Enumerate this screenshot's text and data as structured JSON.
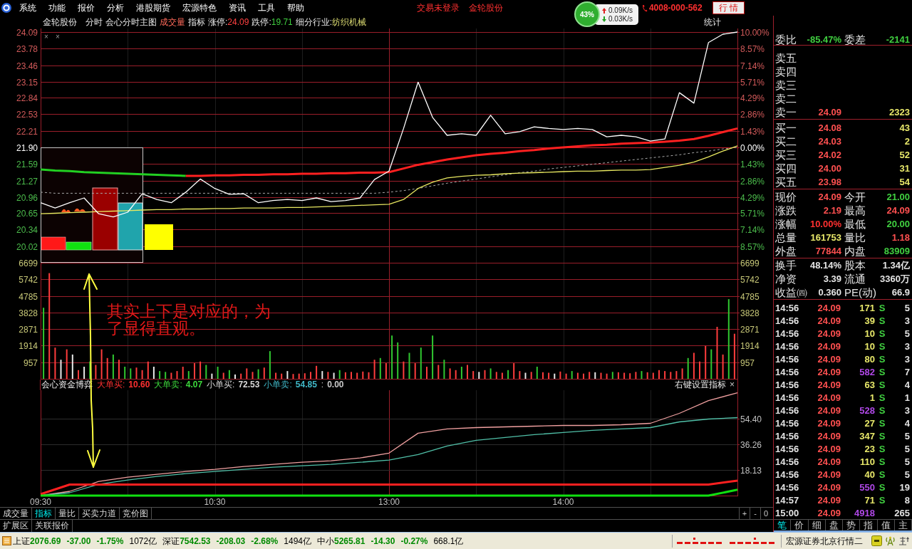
{
  "menu_bar": {
    "items": [
      "系统",
      "功能",
      "报价",
      "分析",
      "港股期货",
      "宏源特色",
      "资讯",
      "工具",
      "帮助"
    ],
    "login_status": "交易未登录",
    "stock_name": "金轮股份",
    "phone": "4008-000-562",
    "quote_button": "行 情"
  },
  "network_monitor": {
    "percent": "43%",
    "upload": "0.09K/s",
    "download": "0.03K/s"
  },
  "chart_header": {
    "stock_name": "金轮股份",
    "items": [
      {
        "label": "分时",
        "highlighted": false
      },
      {
        "label": "会心分时主图",
        "highlighted": false
      },
      {
        "label": "成交量",
        "highlighted": true
      },
      {
        "label": "指标",
        "highlighted": false
      }
    ],
    "limit_up": {
      "label": "涨停:",
      "value": "24.09"
    },
    "limit_down": {
      "label": "跌停:",
      "value": "19.71"
    },
    "industry": {
      "label": "细分行业:",
      "value": "纺织机械"
    },
    "stats_button": "统计"
  },
  "price_pane": {
    "close_marks": [
      "×",
      "×"
    ],
    "percent_labels": [
      "10.00%",
      "8.57%",
      "7.14%",
      "5.71%",
      "4.29%",
      "2.86%",
      "1.43%",
      "0.00%",
      "1.43%",
      "2.86%",
      "4.29%",
      "5.71%",
      "7.14%",
      "8.57%"
    ],
    "chart_data": {
      "type": "line",
      "categories": [
        null,
        null,
        null,
        null,
        null,
        null,
        null,
        null,
        null,
        null,
        null,
        null,
        null,
        null,
        null,
        null,
        null,
        null,
        null,
        null,
        null,
        null,
        null,
        null,
        null,
        null,
        null,
        null,
        null,
        null,
        null,
        null,
        null,
        null,
        null,
        null,
        null,
        null,
        null,
        null,
        null,
        null,
        null,
        null,
        null,
        null,
        null,
        null,
        null
      ],
      "ylim": [
        19.71,
        24.09
      ],
      "yticks": [
        24.09,
        23.78,
        23.46,
        23.15,
        22.84,
        22.53,
        22.21,
        {
          "value": 21.9,
          "label": "21.90"
        },
        21.59,
        21.27,
        20.96,
        20.65,
        20.34,
        20.02
      ],
      "grid": true,
      "ref_lines": [
        {
          "axis": "y",
          "value": 21.9
        }
      ],
      "series": [
        {
          "color": "#a8a8a8",
          "line_style": "dashed",
          "values": [
            21.05,
            21.03,
            21.03,
            21.03,
            21.03,
            21.03,
            21.03,
            21.03,
            21.03,
            21.03,
            21.03,
            21.03,
            21.03,
            21.03,
            21.03,
            21.03,
            21.03,
            21.03,
            21.03,
            21.03,
            21.03,
            21.03,
            21.03,
            21.03,
            21.05,
            21.08,
            21.12,
            21.17,
            21.22,
            21.26,
            21.3,
            21.34,
            21.38,
            21.42,
            21.45,
            21.49,
            21.52,
            21.55,
            21.58,
            21.61,
            21.64,
            21.67,
            21.7,
            21.73,
            21.76,
            21.8,
            21.83,
            21.87,
            21.9
          ]
        },
        {
          "color": "#22d022",
          "line_style": "solid",
          "values": [
            21.48,
            21.46,
            21.45,
            21.43,
            21.42,
            21.41,
            21.4,
            21.39,
            21.38,
            21.37,
            21.36,
            null,
            null,
            null,
            null,
            null,
            null,
            null,
            null,
            null,
            null,
            null,
            null,
            null,
            null,
            null,
            null,
            null,
            null,
            null,
            null,
            null,
            null,
            null,
            null,
            null,
            null,
            null,
            null,
            null,
            null,
            null,
            null,
            null,
            null,
            null,
            null,
            null,
            null
          ]
        },
        {
          "color": "#ff2020",
          "line_style": "solid",
          "values": [
            null,
            null,
            null,
            null,
            null,
            null,
            null,
            null,
            null,
            null,
            21.36,
            21.36,
            21.37,
            21.37,
            21.38,
            21.38,
            21.39,
            21.39,
            21.4,
            21.4,
            21.41,
            21.41,
            21.42,
            21.42,
            21.43,
            21.5,
            21.57,
            21.62,
            21.67,
            21.71,
            21.75,
            21.78,
            21.8,
            21.83,
            21.85,
            21.88,
            21.9,
            21.92,
            21.94,
            21.95,
            21.97,
            21.98,
            21.99,
            22.01,
            22.03,
            22.06,
            22.12,
            22.19,
            22.26
          ]
        },
        {
          "color": "#e8e860",
          "line_style": "solid",
          "values": [
            20.64,
            20.65,
            20.66,
            20.67,
            20.68,
            20.69,
            20.7,
            20.71,
            20.72,
            20.72,
            20.73,
            20.73,
            20.74,
            20.74,
            20.75,
            20.75,
            20.75,
            20.76,
            20.76,
            20.77,
            20.78,
            20.79,
            20.8,
            20.81,
            20.82,
            20.91,
            21.12,
            21.24,
            21.32,
            21.35,
            21.37,
            21.38,
            21.4,
            21.41,
            21.42,
            21.43,
            21.44,
            21.45,
            21.45,
            21.46,
            21.47,
            21.47,
            21.48,
            21.52,
            21.56,
            21.62,
            21.72,
            21.83,
            21.93
          ]
        },
        {
          "color": "#ffffff",
          "line_style": "solid",
          "values": [
            20.85,
            20.75,
            20.85,
            20.94,
            20.64,
            20.58,
            20.67,
            21.02,
            20.91,
            20.85,
            21.05,
            21.3,
            21.12,
            21.01,
            21.02,
            20.85,
            20.89,
            20.91,
            20.89,
            20.94,
            20.87,
            20.89,
            20.94,
            21.29,
            21.45,
            22.26,
            23.14,
            22.47,
            22.13,
            22.16,
            22.13,
            22.51,
            22.16,
            22.2,
            22.29,
            22.26,
            22.24,
            22.26,
            22.24,
            22.1,
            22.13,
            22.1,
            22.02,
            22.06,
            22.94,
            22.74,
            23.89,
            24.05,
            24.09
          ]
        }
      ]
    }
  },
  "volume_pane": {
    "right_labels": [
      "6699",
      "5742",
      "4785",
      "3828",
      "2871",
      "1914",
      "957"
    ],
    "chart_data": {
      "type": "bar",
      "stacked": true,
      "categories": [
        null,
        null,
        null,
        null,
        null,
        null,
        null,
        null,
        null,
        null,
        null,
        null,
        null,
        null,
        null,
        null,
        null,
        null,
        null,
        null,
        null,
        null,
        null,
        null,
        null,
        null,
        null,
        null,
        null,
        null,
        null,
        null,
        null,
        null,
        null,
        null,
        null,
        null,
        null,
        null,
        null,
        null,
        null,
        null,
        null,
        null,
        null,
        null,
        null,
        null,
        null,
        null,
        null,
        null,
        null,
        null,
        null,
        null,
        null,
        null,
        null,
        null,
        null,
        null,
        null,
        null,
        null,
        null,
        null,
        null,
        null,
        null,
        null,
        null,
        null,
        null,
        null,
        null,
        null,
        null,
        null,
        null,
        null,
        null,
        null,
        null,
        null,
        null,
        null,
        null,
        null,
        null,
        null,
        null,
        null,
        null,
        null,
        null,
        null,
        null,
        null,
        null,
        null,
        null,
        null,
        null,
        null,
        null,
        null,
        null,
        null,
        null,
        null,
        null,
        null,
        null,
        null,
        null,
        null,
        null
      ],
      "ylim": [
        0,
        6699
      ],
      "yticks": [
        6699,
        5742,
        4785,
        3828,
        2871,
        1914,
        957
      ],
      "grid": true,
      "series": [
        {
          "color": "#ff3c3c",
          "values": [
            0,
            6100,
            1800,
            0,
            1700,
            0,
            500,
            0,
            0,
            800,
            1700,
            1200,
            0,
            1100,
            0,
            0,
            650,
            500,
            1000,
            0,
            0,
            0,
            350,
            450,
            700,
            0,
            900,
            1000,
            0,
            0,
            0,
            350,
            0,
            0,
            300,
            600,
            400,
            0,
            650,
            0,
            350,
            300,
            0,
            280,
            300,
            320,
            400,
            750,
            0,
            400,
            0,
            0,
            380,
            400,
            350,
            420,
            380,
            1100,
            0,
            900,
            0,
            0,
            1000,
            0,
            900,
            0,
            700,
            0,
            800,
            0,
            600,
            500,
            0,
            800,
            450,
            0,
            500,
            0,
            400,
            350,
            0,
            900,
            450,
            0,
            400,
            0,
            380,
            350,
            0,
            420,
            300,
            0,
            350,
            300,
            400,
            0,
            350,
            300,
            0,
            380,
            350,
            320,
            400,
            0,
            380,
            350,
            500,
            450,
            400,
            450,
            600,
            0,
            1500,
            1000,
            1900,
            0,
            3000,
            1400,
            0,
            2600
          ]
        },
        {
          "color": "#30c830",
          "values": [
            4100,
            0,
            0,
            0,
            0,
            0,
            0,
            0,
            1000,
            0,
            0,
            0,
            1400,
            0,
            700,
            600,
            0,
            0,
            0,
            0,
            450,
            400,
            0,
            0,
            0,
            450,
            0,
            0,
            800,
            0,
            700,
            0,
            500,
            0,
            0,
            0,
            0,
            550,
            0,
            1600,
            0,
            0,
            0,
            0,
            0,
            0,
            0,
            0,
            0,
            0,
            0,
            500,
            0,
            0,
            0,
            0,
            0,
            0,
            1200,
            0,
            2500,
            2100,
            0,
            1500,
            0,
            1800,
            0,
            2500,
            0,
            1100,
            0,
            0,
            700,
            0,
            0,
            0,
            0,
            600,
            0,
            0,
            500,
            0,
            0,
            0,
            0,
            700,
            0,
            0,
            0,
            0,
            0,
            450,
            0,
            0,
            0,
            0,
            0,
            0,
            400,
            0,
            0,
            0,
            0,
            450,
            0,
            0,
            0,
            0,
            0,
            0,
            0,
            1200,
            0,
            0,
            0,
            1700,
            0,
            0,
            4600,
            0
          ]
        },
        {
          "color": "#e8e8e8",
          "values": [
            0,
            0,
            0,
            1100,
            0,
            1400,
            0,
            700,
            0,
            0,
            0,
            0,
            0,
            0,
            0,
            0,
            0,
            0,
            0,
            700,
            0,
            0,
            0,
            0,
            0,
            0,
            0,
            0,
            0,
            300,
            0,
            0,
            0,
            250,
            0,
            0,
            0,
            0,
            0,
            0,
            0,
            0,
            450,
            0,
            0,
            0,
            0,
            0,
            450,
            0,
            350,
            0,
            0,
            0,
            0,
            0,
            0,
            0,
            0,
            0,
            0,
            0,
            0,
            0,
            0,
            0,
            0,
            0,
            0,
            0,
            0,
            0,
            0,
            0,
            0,
            400,
            0,
            0,
            0,
            0,
            0,
            0,
            0,
            350,
            0,
            0,
            0,
            0,
            300,
            0,
            0,
            0,
            0,
            0,
            0,
            380,
            0,
            0,
            0,
            0,
            0,
            0,
            0,
            0,
            0,
            0,
            0,
            0,
            0,
            0,
            0,
            0,
            0,
            0,
            0,
            0,
            0,
            0,
            0,
            0
          ]
        }
      ]
    }
  },
  "indicator_pane": {
    "name": "会心资金博弈",
    "legend": [
      {
        "label": "大单买:",
        "value": "10.60",
        "color": "#ff3030"
      },
      {
        "label": "大单卖:",
        "value": "4.07",
        "color": "#3cd83c"
      },
      {
        "label": "小单买:",
        "value": "72.53",
        "color": "#d8d8d8"
      },
      {
        "label": "小单卖:",
        "value": "54.85",
        "color": "#40b8c8"
      },
      {
        "label": ":",
        "value": "0.00",
        "color": "#c8c8c8"
      }
    ],
    "settings_hint": "右键设置指标",
    "close": "×",
    "chart_data": {
      "type": "line",
      "categories": [
        "09:30",
        null,
        null,
        null,
        null,
        null,
        "10:30",
        null,
        null,
        null,
        null,
        null,
        "13:00",
        null,
        null,
        null,
        null,
        null,
        "14:00",
        null,
        null,
        null,
        null,
        null,
        null
      ],
      "ylim": [
        0,
        74.35
      ],
      "yticks": [
        {
          "value": 54.4,
          "label": "54.40"
        },
        {
          "value": 36.26,
          "label": "36.26"
        },
        {
          "value": 18.13,
          "label": "18.13"
        }
      ],
      "grid": true,
      "series": [
        {
          "color": "#f0a0a0",
          "line_style": "solid",
          "values": [
            0,
            3,
            10,
            13,
            15,
            17,
            18.5,
            20.5,
            22,
            23.5,
            24.5,
            26.5,
            30,
            44,
            47,
            48,
            48.5,
            49,
            49.5,
            49.5,
            50,
            51,
            58,
            67,
            72.5
          ]
        },
        {
          "color": "#50c0a8",
          "line_style": "solid",
          "values": [
            0,
            2,
            8,
            11,
            13.5,
            15.5,
            17,
            18.5,
            20,
            21,
            22,
            23.5,
            25,
            29,
            35,
            39,
            41,
            43,
            44.5,
            46,
            47,
            48,
            52,
            54,
            55
          ]
        },
        {
          "color": "#ff2020",
          "line_style": "solid",
          "values": [
            1,
            7.8,
            7.8,
            7.8,
            7.8,
            7.8,
            7.8,
            7.8,
            7.8,
            7.8,
            7.8,
            7.8,
            7.8,
            7.8,
            7.8,
            7.8,
            7.8,
            7.8,
            7.8,
            7.8,
            7.8,
            7.8,
            7.8,
            7.8,
            10.6
          ]
        },
        {
          "color": "#10e010",
          "line_style": "solid",
          "values": [
            0,
            0,
            0,
            0,
            0,
            0,
            0,
            0,
            0,
            0,
            0,
            0,
            0,
            0,
            0,
            0,
            0,
            0,
            0,
            0,
            0,
            0,
            0,
            0,
            4.1
          ]
        }
      ]
    }
  },
  "annotation": {
    "text": "其实上下是对应的，为了显得直观。"
  },
  "bottom_tabs": [
    {
      "label": "成交量",
      "selected": false
    },
    {
      "label": "指标",
      "selected": true
    },
    {
      "label": "量比",
      "selected": false
    },
    {
      "label": "买卖力道",
      "selected": false
    },
    {
      "label": "竞价图",
      "selected": false
    }
  ],
  "zoom_buttons": [
    "+",
    "-",
    "0"
  ],
  "extension_tabs": [
    "扩展区",
    "关联报价"
  ],
  "quote_panel": {
    "order_ratio": [
      {
        "label": "委比",
        "value": "-85.47%",
        "color": "#40d040"
      },
      {
        "label": "委差",
        "value": "-2141",
        "color": "#40d040"
      }
    ],
    "asks": [
      {
        "label": "卖五"
      },
      {
        "label": "卖四"
      },
      {
        "label": "卖三"
      },
      {
        "label": "卖二"
      },
      {
        "label": "卖一",
        "price": "24.09",
        "volume": "2323"
      }
    ],
    "bids": [
      {
        "label": "买一",
        "price": "24.08",
        "volume": "43"
      },
      {
        "label": "买二",
        "price": "24.03",
        "volume": "2"
      },
      {
        "label": "买三",
        "price": "24.02",
        "volume": "52"
      },
      {
        "label": "买四",
        "price": "24.00",
        "volume": "31"
      },
      {
        "label": "买五",
        "price": "23.98",
        "volume": "54"
      }
    ],
    "stats": [
      {
        "label": "现价",
        "value": "24.09",
        "color": "#ff5050"
      },
      {
        "label": "今开",
        "value": "21.00",
        "color": "#40d040"
      },
      {
        "label": "涨跌",
        "value": "2.19",
        "color": "#ff5050"
      },
      {
        "label": "最高",
        "value": "24.09",
        "color": "#ff5050"
      },
      {
        "label": "涨幅",
        "value": "10.00%",
        "color": "#ff3030"
      },
      {
        "label": "最低",
        "value": "20.00",
        "color": "#40d040"
      },
      {
        "label": "总量",
        "value": "161753",
        "color": "#e8e86a"
      },
      {
        "label": "量比",
        "value": "1.18",
        "color": "#ff5050"
      },
      {
        "label": "外盘",
        "value": "77844",
        "color": "#ff5050"
      },
      {
        "label": "内盘",
        "value": "83909",
        "color": "#40d040"
      }
    ],
    "fundamentals": [
      {
        "label": "换手",
        "value": "48.14%"
      },
      {
        "label": "股本",
        "value": "1.34亿"
      },
      {
        "label": "净资",
        "value": "3.39"
      },
      {
        "label": "流通",
        "value": "3360万"
      },
      {
        "label": "收益㈣",
        "value": "0.360"
      },
      {
        "label": "PE(动)",
        "value": "66.9"
      }
    ],
    "trades": [
      {
        "time": "14:56",
        "price": "24.09",
        "volume": "171",
        "side": "S",
        "count": "5",
        "large": false
      },
      {
        "time": "14:56",
        "price": "24.09",
        "volume": "39",
        "side": "S",
        "count": "3",
        "large": false
      },
      {
        "time": "14:56",
        "price": "24.09",
        "volume": "10",
        "side": "S",
        "count": "5",
        "large": false
      },
      {
        "time": "14:56",
        "price": "24.09",
        "volume": "10",
        "side": "S",
        "count": "3",
        "large": false
      },
      {
        "time": "14:56",
        "price": "24.09",
        "volume": "80",
        "side": "S",
        "count": "3",
        "large": false
      },
      {
        "time": "14:56",
        "price": "24.09",
        "volume": "582",
        "side": "S",
        "count": "7",
        "large": true
      },
      {
        "time": "14:56",
        "price": "24.09",
        "volume": "63",
        "side": "S",
        "count": "4",
        "large": false
      },
      {
        "time": "14:56",
        "price": "24.09",
        "volume": "1",
        "side": "S",
        "count": "1",
        "large": false
      },
      {
        "time": "14:56",
        "price": "24.09",
        "volume": "528",
        "side": "S",
        "count": "3",
        "large": true
      },
      {
        "time": "14:56",
        "price": "24.09",
        "volume": "27",
        "side": "S",
        "count": "4",
        "large": false
      },
      {
        "time": "14:56",
        "price": "24.09",
        "volume": "347",
        "side": "S",
        "count": "5",
        "large": false
      },
      {
        "time": "14:56",
        "price": "24.09",
        "volume": "23",
        "side": "S",
        "count": "5",
        "large": false
      },
      {
        "time": "14:56",
        "price": "24.09",
        "volume": "110",
        "side": "S",
        "count": "5",
        "large": false
      },
      {
        "time": "14:56",
        "price": "24.09",
        "volume": "40",
        "side": "S",
        "count": "5",
        "large": false
      },
      {
        "time": "14:56",
        "price": "24.09",
        "volume": "550",
        "side": "S",
        "count": "19",
        "large": true
      },
      {
        "time": "14:57",
        "price": "24.09",
        "volume": "71",
        "side": "S",
        "count": "8",
        "large": false
      },
      {
        "time": "15:00",
        "price": "24.09",
        "volume": "4918",
        "count": "265",
        "large": true
      }
    ],
    "tabs": [
      {
        "label": "笔",
        "selected": true
      },
      {
        "label": "价",
        "selected": false
      },
      {
        "label": "细",
        "selected": false
      },
      {
        "label": "盘",
        "selected": false
      },
      {
        "label": "势",
        "selected": false
      },
      {
        "label": "指",
        "selected": false
      },
      {
        "label": "值",
        "selected": false
      },
      {
        "label": "主",
        "selected": false
      }
    ]
  },
  "status_bar": {
    "indices": [
      {
        "name": "上证",
        "value": "2076.69",
        "change": "-37.00",
        "percent": "-1.75%",
        "amount": "1072亿"
      },
      {
        "name": "深证",
        "value": "7542.53",
        "change": "-208.03",
        "percent": "-2.68%",
        "amount": "1494亿"
      },
      {
        "name": "中小",
        "value": "5265.81",
        "change": "-14.30",
        "percent": "-0.27%",
        "amount": "668.1亿"
      }
    ],
    "server": "宏源证券北京行情二"
  }
}
